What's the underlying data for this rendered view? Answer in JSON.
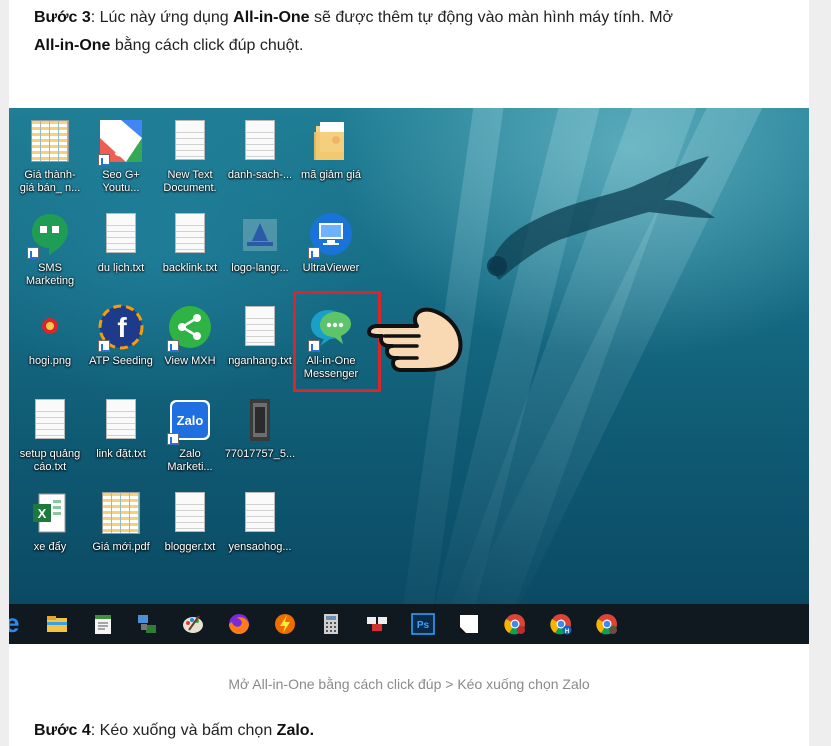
{
  "steps": {
    "step3": {
      "prefix_bold": "Bước 3",
      "t1": ": Lúc này ứng dụng ",
      "app_bold": "All-in-One",
      "t2": " sẽ được thêm tự động vào màn hình máy tính. Mở ",
      "app_bold2": "All-in-One",
      "t3": " bằng cách click đúp chuột."
    },
    "step4": {
      "prefix_bold": "Bước 4",
      "t1": ": Kéo xuống và bấm chọn ",
      "target_bold": "Zalo."
    }
  },
  "caption": "Mở All-in-One bằng cách click đúp > Kéo xuống chọn Zalo",
  "desktop": {
    "icons": [
      {
        "label": "Giá thành-\ngiá bán_ n...",
        "icon": "spreadsheet-icon"
      },
      {
        "label": "Seo G+\nYoutu...",
        "icon": "google-plus-icon"
      },
      {
        "label": "New Text\nDocument.",
        "icon": "text-document-icon"
      },
      {
        "label": "danh-sach-...",
        "icon": "text-document-icon"
      },
      {
        "label": "mã giảm giá",
        "icon": "folder-icon"
      },
      {
        "label": "SMS\nMarketing",
        "icon": "hangouts-icon"
      },
      {
        "label": "du lịch.txt",
        "icon": "text-document-icon"
      },
      {
        "label": "backlink.txt",
        "icon": "text-document-icon"
      },
      {
        "label": "logo-langr...",
        "icon": "image-file-icon"
      },
      {
        "label": "UltraViewer",
        "icon": "monitor-icon"
      },
      {
        "label": "hogi.png",
        "icon": "image-file-icon"
      },
      {
        "label": "ATP Seeding",
        "icon": "facebook-icon"
      },
      {
        "label": "View MXH",
        "icon": "share-icon"
      },
      {
        "label": "nganhang.txt",
        "icon": "text-document-icon"
      },
      {
        "label": "All-in-One\nMessenger",
        "icon": "messenger-chat-icon"
      },
      {
        "label": "setup quảng\ncáo.txt",
        "icon": "text-document-icon"
      },
      {
        "label": "link đặt.txt",
        "icon": "text-document-icon"
      },
      {
        "label": "Zalo\nMarketi...",
        "icon": "zalo-icon"
      },
      {
        "label": "77017757_5...",
        "icon": "video-file-icon"
      },
      {
        "label": "xe đẩy",
        "icon": "excel-icon"
      },
      {
        "label": "Giá mới.pdf",
        "icon": "pdf-icon"
      },
      {
        "label": "blogger.txt",
        "icon": "text-document-icon"
      },
      {
        "label": "yensaohog...",
        "icon": "text-document-icon"
      }
    ],
    "taskbar": {
      "items": [
        "windows-start-icon",
        "file-explorer-icon",
        "notepad-icon",
        "network-icon",
        "paint-icon",
        "firefox-icon",
        "lightning-app-icon",
        "calculator-icon",
        "remote-desktop-icon",
        "photoshop-icon",
        "sticky-notes-icon",
        "chrome-icon",
        "chrome-profile-icon",
        "chrome-profile2-icon"
      ],
      "start_text": "e",
      "ps_text": "Ps",
      "chrome_badge": "H"
    },
    "colors": {
      "highlight": "#d8262b",
      "water": "#176e87",
      "taskbar": "#101820"
    }
  }
}
